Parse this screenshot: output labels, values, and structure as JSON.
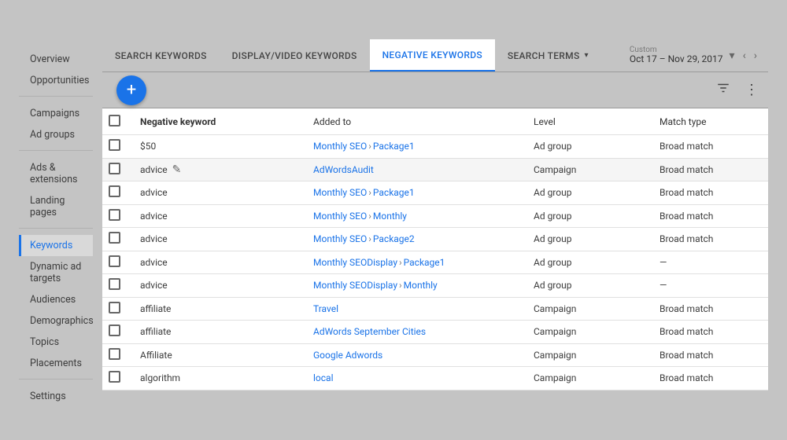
{
  "sidebar": {
    "groups": [
      {
        "items": [
          "Overview",
          "Opportunities"
        ]
      },
      {
        "items": [
          "Campaigns",
          "Ad groups"
        ]
      },
      {
        "items": [
          "Ads & extensions",
          "Landing pages"
        ]
      },
      {
        "items": [
          "Keywords",
          "Dynamic ad targets",
          "Audiences",
          "Demographics",
          "Topics",
          "Placements"
        ]
      },
      {
        "items": [
          "Settings"
        ]
      }
    ],
    "active": "Keywords"
  },
  "tabs": {
    "items": [
      "SEARCH KEYWORDS",
      "DISPLAY/VIDEO KEYWORDS",
      "NEGATIVE KEYWORDS",
      "SEARCH TERMS"
    ],
    "active_index": 2,
    "dropdown_on": [
      3
    ]
  },
  "date_range": {
    "label": "Custom",
    "value": "Oct 17 – Nov 29, 2017"
  },
  "table": {
    "headers": {
      "keyword": "Negative keyword",
      "added_to": "Added to",
      "level": "Level",
      "match_type": "Match type"
    },
    "rows": [
      {
        "keyword": "$50",
        "added_to": [
          "Monthly SEO",
          "Package1"
        ],
        "level": "Ad group",
        "match": "Broad match",
        "hover": false,
        "editable": false
      },
      {
        "keyword": "advice",
        "added_to": [
          "AdWordsAudit"
        ],
        "level": "Campaign",
        "match": "Broad match",
        "hover": true,
        "editable": true
      },
      {
        "keyword": "advice",
        "added_to": [
          "Monthly SEO",
          "Package1"
        ],
        "level": "Ad group",
        "match": "Broad match",
        "hover": false,
        "editable": false
      },
      {
        "keyword": "advice",
        "added_to": [
          "Monthly SEO",
          "Monthly"
        ],
        "level": "Ad group",
        "match": "Broad match",
        "hover": false,
        "editable": false
      },
      {
        "keyword": "advice",
        "added_to": [
          "Monthly SEO",
          "Package2"
        ],
        "level": "Ad group",
        "match": "Broad match",
        "hover": false,
        "editable": false
      },
      {
        "keyword": "advice",
        "added_to": [
          "Monthly SEODisplay",
          "Package1"
        ],
        "level": "Ad group",
        "match": "—",
        "hover": false,
        "editable": false
      },
      {
        "keyword": "advice",
        "added_to": [
          "Monthly SEODisplay",
          "Monthly"
        ],
        "level": "Ad group",
        "match": "—",
        "hover": false,
        "editable": false
      },
      {
        "keyword": "affiliate",
        "added_to": [
          "Travel"
        ],
        "level": "Campaign",
        "match": "Broad match",
        "hover": false,
        "editable": false
      },
      {
        "keyword": "affiliate",
        "added_to": [
          "AdWords September Cities"
        ],
        "level": "Campaign",
        "match": "Broad match",
        "hover": false,
        "editable": false
      },
      {
        "keyword": "Affiliate",
        "added_to": [
          "Google Adwords"
        ],
        "level": "Campaign",
        "match": "Broad match",
        "hover": false,
        "editable": false
      },
      {
        "keyword": "algorithm",
        "added_to": [
          "local"
        ],
        "level": "Campaign",
        "match": "Broad match",
        "hover": false,
        "editable": false
      }
    ]
  }
}
